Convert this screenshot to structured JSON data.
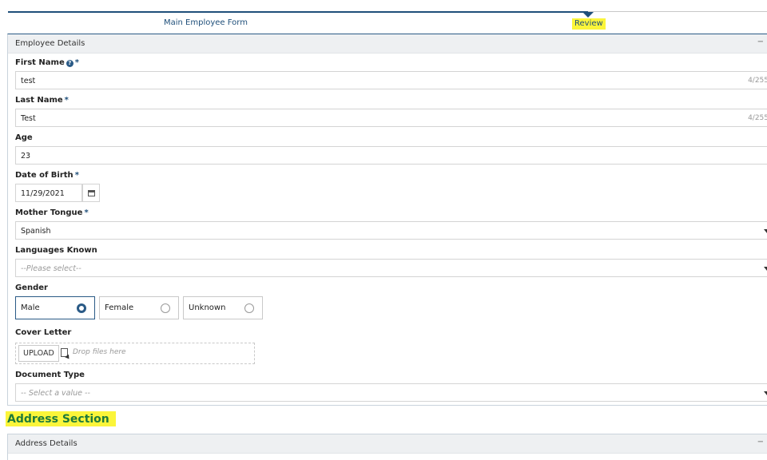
{
  "stepper": {
    "steps": [
      {
        "label": "Main Employee Form"
      },
      {
        "label": "Review"
      }
    ]
  },
  "employee_panel": {
    "title": "Employee Details",
    "collapse_glyph": "−"
  },
  "fields": {
    "first_name": {
      "label": "First Name",
      "required": "*",
      "value": "test",
      "counter": "4/255"
    },
    "last_name": {
      "label": "Last Name",
      "required": "*",
      "value": "Test",
      "counter": "4/255"
    },
    "age": {
      "label": "Age",
      "value": "23"
    },
    "dob": {
      "label": "Date of Birth",
      "required": "*",
      "value": "11/29/2021"
    },
    "mother_tongue": {
      "label": "Mother Tongue",
      "required": "*",
      "value": "Spanish"
    },
    "languages": {
      "label": "Languages Known",
      "placeholder": "--Please select--"
    },
    "gender": {
      "label": "Gender",
      "options": [
        {
          "label": "Male",
          "selected": true
        },
        {
          "label": "Female",
          "selected": false
        },
        {
          "label": "Unknown",
          "selected": false
        }
      ]
    },
    "cover_letter": {
      "label": "Cover Letter",
      "upload_label": "UPLOAD",
      "drop_text": "Drop files here"
    },
    "document_type": {
      "label": "Document Type",
      "placeholder": "-- Select a value --"
    }
  },
  "address": {
    "section_title": "Address Section",
    "panel_title": "Address Details",
    "collapse_glyph": "−"
  },
  "colors": {
    "accent": "#2a5a86",
    "highlight": "#fbf53a",
    "section_green": "#1e7a3a"
  }
}
